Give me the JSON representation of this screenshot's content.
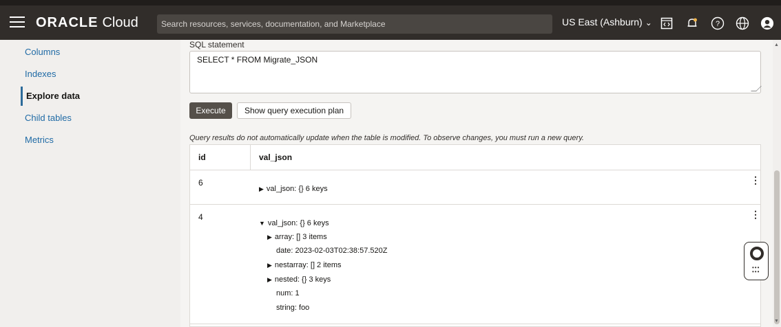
{
  "topbar": {
    "logo_brand": "ORACLE",
    "logo_product": "Cloud",
    "search_placeholder": "Search resources, services, documentation, and Marketplace",
    "region": "US East (Ashburn)",
    "icons": [
      "menu-icon",
      "chevron-down-icon",
      "code-editor-icon",
      "bell-icon",
      "help-icon",
      "globe-icon",
      "profile-icon"
    ]
  },
  "sidebar": {
    "items": [
      {
        "label": "Columns",
        "active": false
      },
      {
        "label": "Indexes",
        "active": false
      },
      {
        "label": "Explore data",
        "active": true
      },
      {
        "label": "Child tables",
        "active": false
      },
      {
        "label": "Metrics",
        "active": false
      }
    ]
  },
  "query": {
    "label": "SQL statement",
    "statement": "SELECT * FROM Migrate_JSON",
    "execute_label": "Execute",
    "plan_label": "Show query execution plan",
    "note": "Query results do not automatically update when the table is modified. To observe changes, you must run a new query."
  },
  "results": {
    "headers": [
      "id",
      "val_json"
    ],
    "rows": [
      {
        "id": "6",
        "tree": [
          {
            "arrow": "▶",
            "text": "val_json:  {}  6 keys"
          }
        ]
      },
      {
        "id": "4",
        "tree": [
          {
            "arrow": "▼",
            "text": "val_json:  {}  6 keys"
          },
          {
            "arrow": "▶",
            "text": "array:  []  3 items"
          },
          {
            "arrow": "",
            "text": "date:  2023-02-03T02:38:57.520Z"
          },
          {
            "arrow": "▶",
            "text": "nestarray:  []  2 items"
          },
          {
            "arrow": "▶",
            "text": "nested:  {}  3 keys"
          },
          {
            "arrow": "",
            "text": "num:  1"
          },
          {
            "arrow": "",
            "text": "string:  foo"
          }
        ]
      }
    ]
  },
  "colors": {
    "topbar": "#312d2a",
    "link": "#1f6aa5",
    "execute_button": "#55504a"
  }
}
